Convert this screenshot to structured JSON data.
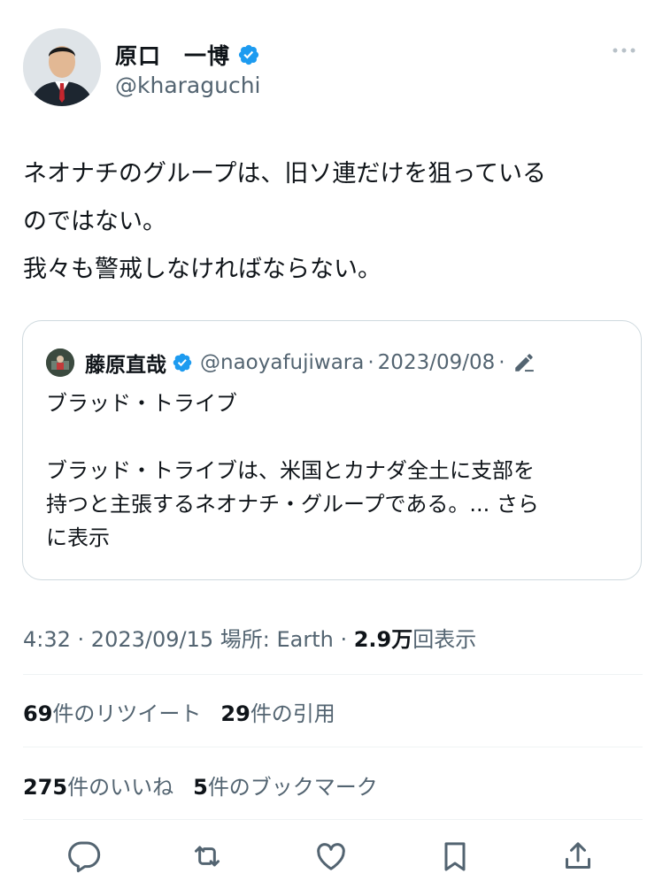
{
  "author": {
    "name": "原口　一博",
    "handle": "@kharaguchi",
    "verified_icon": "verified-badge-icon",
    "avatar_icon": "profile-photo"
  },
  "tweet": {
    "lines": [
      "ネオナチのグループは、旧ソ連だけを狙っている",
      "のではない。",
      "我々も警戒しなければならない。"
    ]
  },
  "quote": {
    "name": "藤原直哉",
    "handle": "@naoyafujiwara",
    "separator": "·",
    "date": "2023/09/08",
    "separator2": "·",
    "title": "ブラッド・トライブ",
    "body_lines": [
      "ブラッド・トライブは、米国とカナダ全土に支部を",
      "持つと主張するネオナチ・グループである。... さら",
      "に表示"
    ]
  },
  "meta": {
    "time": "4:32",
    "sep1": " · ",
    "date": "2023/09/15",
    "location": " 場所: Earth",
    "sep2": " · ",
    "views_num": "2.9万",
    "views_label": "回表示"
  },
  "stats": {
    "retweets_num": "69",
    "retweets_label": "件のリツイート",
    "quotes_num": "29",
    "quotes_label": "件の引用",
    "likes_num": "275",
    "likes_label": "件のいいね",
    "bookmarks_num": "5",
    "bookmarks_label": "件のブックマーク"
  },
  "colors": {
    "accent": "#1d9bf0",
    "text": "#0f1419",
    "secondary": "#536471",
    "border": "#cfd9de"
  },
  "actions": [
    "reply-icon",
    "retweet-icon",
    "like-icon",
    "bookmark-icon",
    "share-icon"
  ]
}
